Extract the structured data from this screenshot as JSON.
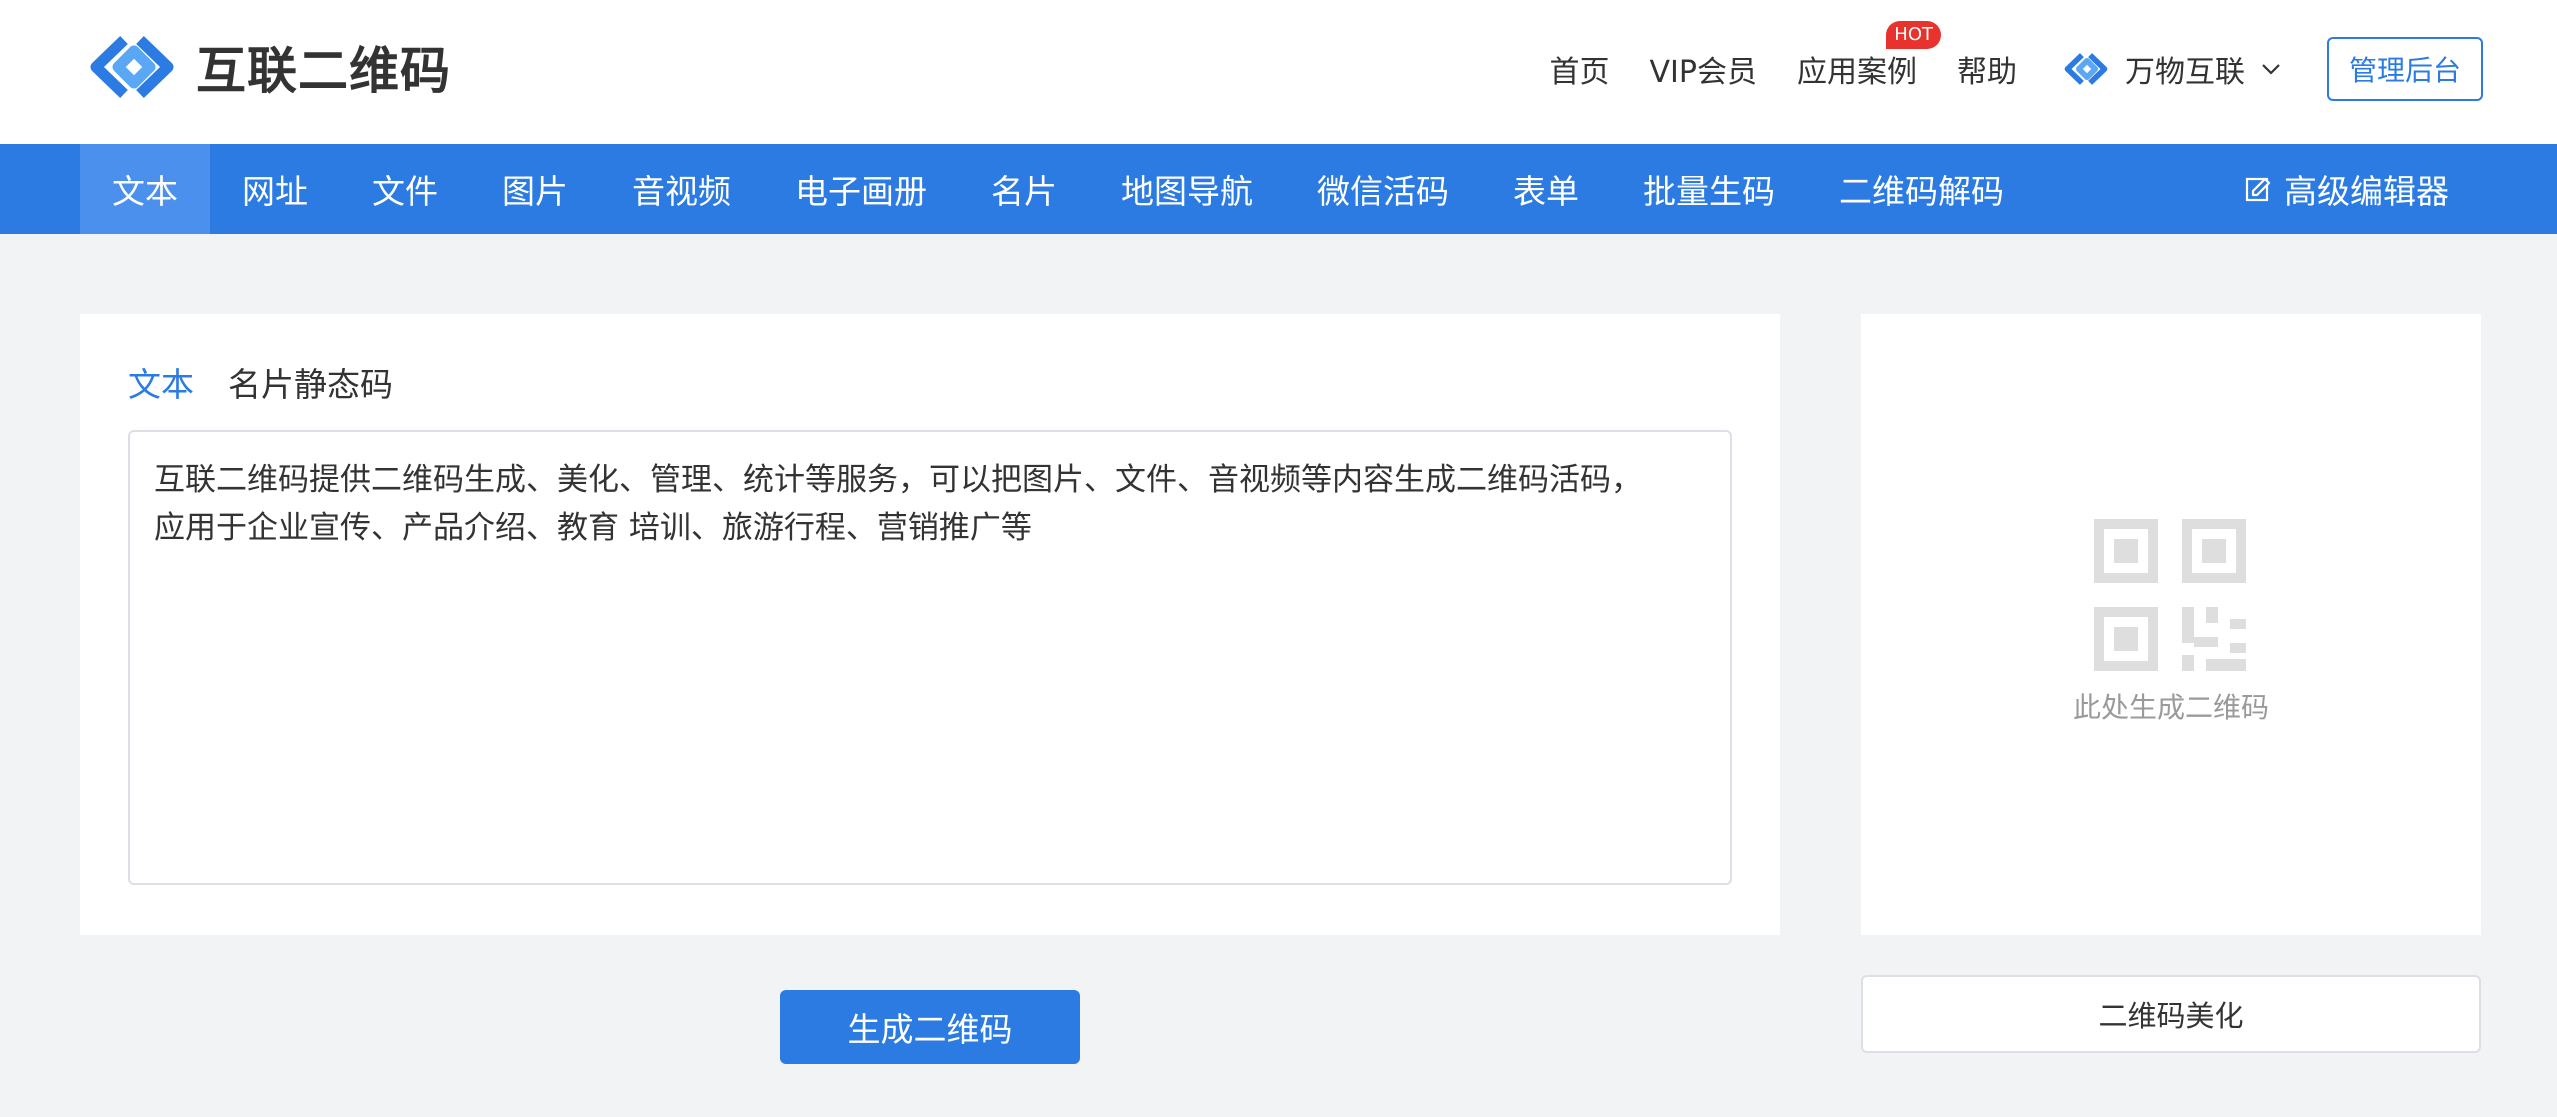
{
  "header": {
    "logo_text": "互联二维码",
    "nav": [
      {
        "label": "首页"
      },
      {
        "label": "VIP会员"
      },
      {
        "label": "应用案例",
        "badge": "HOT"
      },
      {
        "label": "帮助"
      }
    ],
    "brand_menu_label": "万物互联",
    "admin_label": "管理后台"
  },
  "catbar": {
    "items": [
      {
        "label": "文本"
      },
      {
        "label": "网址"
      },
      {
        "label": "文件"
      },
      {
        "label": "图片"
      },
      {
        "label": "音视频"
      },
      {
        "label": "电子画册"
      },
      {
        "label": "名片"
      },
      {
        "label": "地图导航"
      },
      {
        "label": "微信活码"
      },
      {
        "label": "表单"
      },
      {
        "label": "批量生码"
      },
      {
        "label": "二维码解码"
      }
    ],
    "active_index": 0,
    "advanced_editor_label": "高级编辑器"
  },
  "editor": {
    "tabs": [
      {
        "label": "文本"
      },
      {
        "label": "名片静态码"
      }
    ],
    "content_line1": "互联二维码提供二维码生成、美化、管理、统计等服务，可以把图片、文件、音视频等内容生成二维码活码，",
    "content_line2": "应用于企业宣传、产品介绍、教育 培训、旅游行程、营销推广等",
    "generate_label": "生成二维码"
  },
  "preview": {
    "hint": "此处生成二维码",
    "beautify_label": "二维码美化"
  },
  "colors": {
    "primary": "#2b7be3",
    "active_tab": "#4a90ec",
    "badge": "#e8322e",
    "background": "#f2f3f5"
  }
}
